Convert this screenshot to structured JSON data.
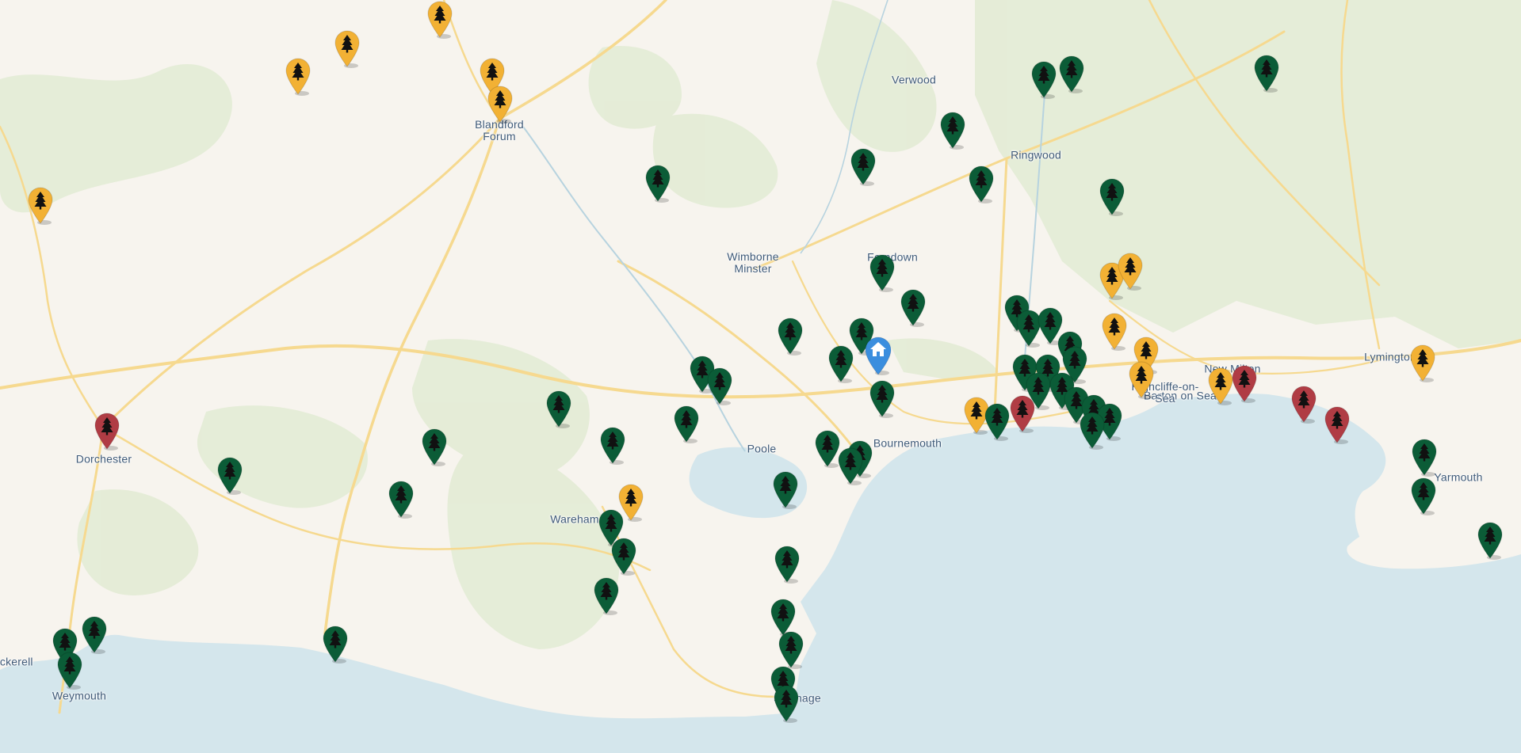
{
  "map": {
    "colors": {
      "land": "#f7f4ee",
      "sea": "#d4e6ec",
      "woodland": "#e2ebd3",
      "road": "#f6d98f",
      "river": "#b7d3df",
      "label": "#3f5a78",
      "home": "#3b8ede"
    },
    "place_labels": [
      "Verwood",
      "Blandford Forum",
      "Ringwood",
      "Wimborne Minster",
      "Ferndown",
      "New Milton",
      "Lymington",
      "Barton on Sea",
      "Highcliffe-on-Sea",
      "Dorchester",
      "Poole",
      "Bournemouth",
      "Wareham",
      "Yarmouth",
      "Chickerell",
      "Weymouth",
      "Swanage"
    ],
    "marker_icon": "tree-icon",
    "home_icon": "home-icon",
    "marker_status_colors": {
      "green": "#0b5c37",
      "amber": "#f2b134",
      "red": "#b03c44"
    },
    "counts": {
      "green": 65,
      "amber": 17,
      "red": 6
    }
  }
}
